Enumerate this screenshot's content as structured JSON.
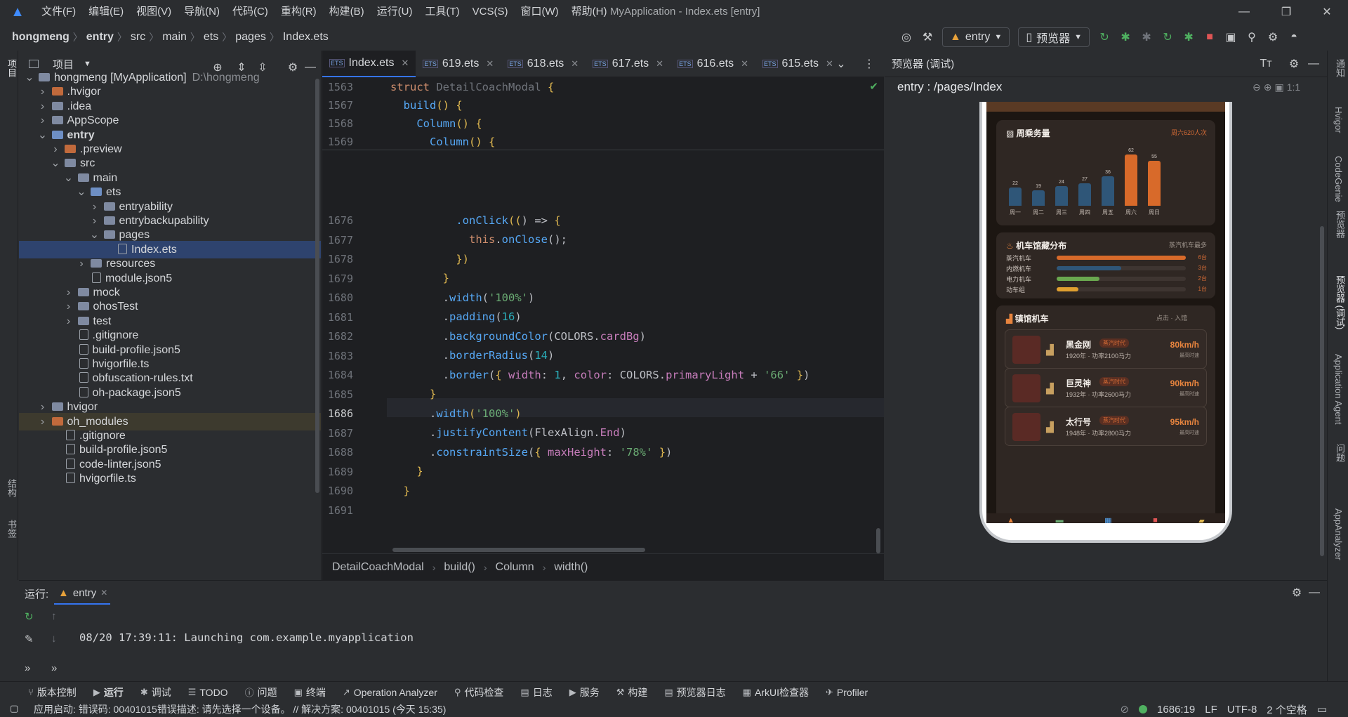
{
  "menubar": {
    "items": [
      "文件(F)",
      "编辑(E)",
      "视图(V)",
      "导航(N)",
      "代码(C)",
      "重构(R)",
      "构建(B)",
      "运行(U)",
      "工具(T)",
      "VCS(S)",
      "窗口(W)",
      "帮助(H)"
    ],
    "title": "MyApplication - Index.ets [entry]"
  },
  "breadcrumb": [
    "hongmeng",
    "entry",
    "src",
    "main",
    "ets",
    "pages",
    "Index.ets"
  ],
  "toolbar": {
    "run_config": "entry",
    "device": "预览器"
  },
  "left_strip": {
    "project": "项目",
    "structure": "结构",
    "bookmarks": "书签"
  },
  "project": {
    "title": "项目",
    "tree": [
      {
        "label": "hongmeng [MyApplication]",
        "extra": "D:\\hongmeng",
        "depth": 0,
        "arrow": "down",
        "icon": "folder"
      },
      {
        "label": ".hvigor",
        "depth": 1,
        "arrow": "right",
        "icon": "folder-orange"
      },
      {
        "label": ".idea",
        "depth": 1,
        "arrow": "right",
        "icon": "folder"
      },
      {
        "label": "AppScope",
        "depth": 1,
        "arrow": "right",
        "icon": "folder"
      },
      {
        "label": "entry",
        "depth": 1,
        "arrow": "down",
        "icon": "folder-blue",
        "bold": true
      },
      {
        "label": ".preview",
        "depth": 2,
        "arrow": "right",
        "icon": "folder-orange"
      },
      {
        "label": "src",
        "depth": 2,
        "arrow": "down",
        "icon": "folder"
      },
      {
        "label": "main",
        "depth": 3,
        "arrow": "down",
        "icon": "folder"
      },
      {
        "label": "ets",
        "depth": 4,
        "arrow": "down",
        "icon": "folder-blue"
      },
      {
        "label": "entryability",
        "depth": 5,
        "arrow": "right",
        "icon": "folder"
      },
      {
        "label": "entrybackupability",
        "depth": 5,
        "arrow": "right",
        "icon": "folder"
      },
      {
        "label": "pages",
        "depth": 5,
        "arrow": "down",
        "icon": "folder"
      },
      {
        "label": "Index.ets",
        "depth": 6,
        "arrow": "",
        "icon": "file",
        "selected": true
      },
      {
        "label": "resources",
        "depth": 4,
        "arrow": "right",
        "icon": "folder"
      },
      {
        "label": "module.json5",
        "depth": 4,
        "arrow": "",
        "icon": "file"
      },
      {
        "label": "mock",
        "depth": 3,
        "arrow": "right",
        "icon": "folder"
      },
      {
        "label": "ohosTest",
        "depth": 3,
        "arrow": "right",
        "icon": "folder"
      },
      {
        "label": "test",
        "depth": 3,
        "arrow": "right",
        "icon": "folder"
      },
      {
        "label": ".gitignore",
        "depth": 3,
        "arrow": "",
        "icon": "file"
      },
      {
        "label": "build-profile.json5",
        "depth": 3,
        "arrow": "",
        "icon": "file"
      },
      {
        "label": "hvigorfile.ts",
        "depth": 3,
        "arrow": "",
        "icon": "file"
      },
      {
        "label": "obfuscation-rules.txt",
        "depth": 3,
        "arrow": "",
        "icon": "file"
      },
      {
        "label": "oh-package.json5",
        "depth": 3,
        "arrow": "",
        "icon": "file"
      },
      {
        "label": "hvigor",
        "depth": 1,
        "arrow": "right",
        "icon": "folder"
      },
      {
        "label": "oh_modules",
        "depth": 1,
        "arrow": "right",
        "icon": "folder-orange",
        "highlight": true
      },
      {
        "label": ".gitignore",
        "depth": 2,
        "arrow": "",
        "icon": "file"
      },
      {
        "label": "build-profile.json5",
        "depth": 2,
        "arrow": "",
        "icon": "file"
      },
      {
        "label": "code-linter.json5",
        "depth": 2,
        "arrow": "",
        "icon": "file"
      },
      {
        "label": "hvigorfile.ts",
        "depth": 2,
        "arrow": "",
        "icon": "file"
      }
    ]
  },
  "editor": {
    "tabs": [
      "Index.ets",
      "619.ets",
      "618.ets",
      "617.ets",
      "616.ets",
      "615.ets"
    ],
    "sticky_lines": [
      "1563",
      "1567",
      "1568",
      "1569"
    ],
    "lines": [
      "1676",
      "1677",
      "1678",
      "1679",
      "1680",
      "1681",
      "1682",
      "1683",
      "1684",
      "1685",
      "1686",
      "1687",
      "1688",
      "1689",
      "1690",
      "1691"
    ],
    "breadcrumb": [
      "DetailCoachModal",
      "build()",
      "Column",
      "width()"
    ]
  },
  "preview": {
    "title": "预览器 (调试)",
    "path": "entry : /pages/Index",
    "weekly_card": {
      "title": "周乘务量",
      "subtitle": "周六620人次"
    },
    "dist_card": {
      "title": "机车馆藏分布",
      "subtitle": "蒸汽机车最多"
    },
    "locos_card": {
      "title": "镇馆机车",
      "subtitle": "点击 · 入馆"
    },
    "locos": [
      {
        "name": "黑金刚",
        "tag": "蒸汽时代",
        "info": "1920年 · 功率2100马力",
        "speed": "80km/h",
        "speed_label": "最高时速"
      },
      {
        "name": "巨灵神",
        "tag": "蒸汽时代",
        "info": "1932年 · 功率2600马力",
        "speed": "90km/h",
        "speed_label": "最高时速"
      },
      {
        "name": "太行号",
        "tag": "蒸汽时代",
        "info": "1948年 · 功率2800马力",
        "speed": "95km/h",
        "speed_label": "最高时速"
      }
    ]
  },
  "chart_data": [
    {
      "type": "bar",
      "title": "周乘务量",
      "categories": [
        "周一",
        "周二",
        "周三",
        "周四",
        "周五",
        "周六",
        "周日"
      ],
      "values": [
        22,
        19,
        24,
        27,
        36,
        62,
        55
      ]
    },
    {
      "type": "bar",
      "title": "机车馆藏分布",
      "categories": [
        "蒸汽机车",
        "内燃机车",
        "电力机车",
        "动车组"
      ],
      "values": [
        6,
        3,
        2,
        1
      ],
      "value_labels": [
        "6台",
        "3台",
        "2台",
        "1台"
      ]
    }
  ],
  "right_strip": [
    "通知",
    "Hvigor",
    "CodeGenie",
    "预览器",
    "预览器 (调试)",
    "Application Agent",
    "问题",
    "AppAnalyzer"
  ],
  "run": {
    "label": "运行:",
    "config": "entry",
    "output": "08/20 17:39:11: Launching com.example.myapplication"
  },
  "toolwindows": [
    "版本控制",
    "运行",
    "调试",
    "TODO",
    "问题",
    "终端",
    "Operation Analyzer",
    "代码检查",
    "日志",
    "服务",
    "构建",
    "预览器日志",
    "ArkUI检查器",
    "Profiler"
  ],
  "status": {
    "message": "应用启动: 错误码: 00401015错误描述: 请先选择一个设备。 // 解决方案: 00401015 (今天 15:35)",
    "position": "1686:19",
    "line_sep": "LF",
    "encoding": "UTF-8",
    "indent": "2 个空格"
  },
  "colors": {
    "accent": "#3574f0",
    "bar_blue": "#2f5678",
    "bar_orange": "#d86a2a"
  }
}
